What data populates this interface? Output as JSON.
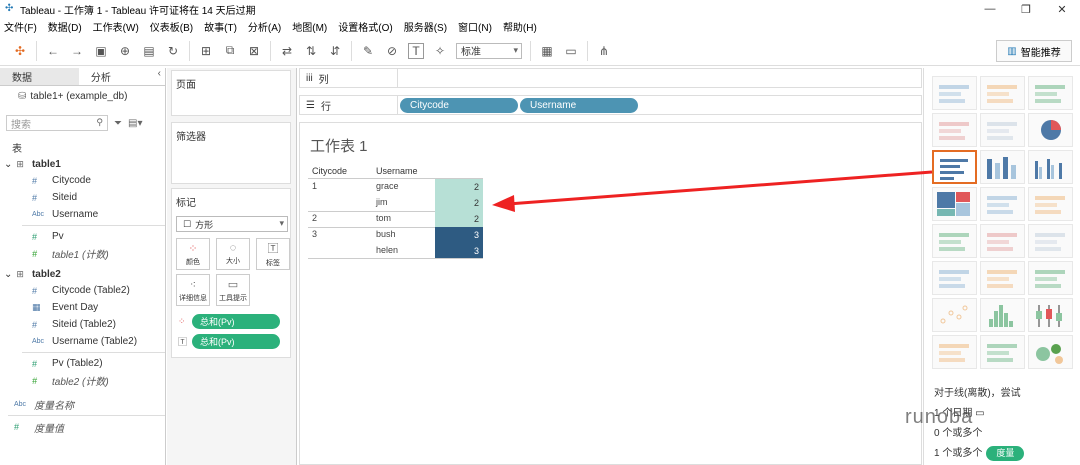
{
  "window": {
    "title": "Tableau - 工作簿 1 - Tableau 许可证将在 14 天后过期"
  },
  "menu": [
    "文件(F)",
    "数据(D)",
    "工作表(W)",
    "仪表板(B)",
    "故事(T)",
    "分析(A)",
    "地图(M)",
    "设置格式(O)",
    "服务器(S)",
    "窗口(N)",
    "帮助(H)"
  ],
  "toolbar": {
    "fit_select": "标准",
    "show_me_label": "智能推荐"
  },
  "left": {
    "tab_data": "数据",
    "tab_analysis": "分析",
    "datasource": "table1+ (example_db)",
    "search_placeholder": "搜索",
    "tables_label": "表",
    "table1": {
      "name": "table1",
      "fields": [
        "Citycode",
        "Siteid",
        "Username",
        "Pv"
      ],
      "count": "table1 (计数)"
    },
    "table2": {
      "name": "table2",
      "fields": [
        "Citycode (Table2)",
        "Event Day",
        "Siteid (Table2)",
        "Username (Table2)",
        "Pv (Table2)"
      ],
      "count": "table2 (计数)"
    },
    "measure_names": "度量名称",
    "measure_values": "度量值"
  },
  "mid": {
    "pages": "页面",
    "filters": "筛选器",
    "marks": "标记",
    "mark_type": "方形",
    "btn_color": "颜色",
    "btn_size": "大小",
    "btn_label": "标签",
    "btn_detail": "详细信息",
    "btn_tooltip": "工具提示",
    "pill1": "总和(Pv)",
    "pill2": "总和(Pv)"
  },
  "shelves": {
    "columns": "列",
    "rows": "行",
    "row_pills": [
      "Citycode",
      "Username"
    ]
  },
  "sheet": {
    "title": "工作表 1",
    "headers": [
      "Citycode",
      "Username"
    ],
    "rows": [
      {
        "city": "1",
        "user": "grace",
        "value": "2"
      },
      {
        "city": "",
        "user": "jim",
        "value": "2"
      },
      {
        "city": "2",
        "user": "tom",
        "value": "2"
      },
      {
        "city": "3",
        "user": "bush",
        "value": "3"
      },
      {
        "city": "",
        "user": "helen",
        "value": "3"
      }
    ],
    "colors": {
      "low": "#b7e0d6",
      "high": "#2e5b82"
    }
  },
  "showme": {
    "hint1": "对于线(离散)，尝试",
    "hint2": "1 个日期",
    "hint3": "0 个或多个",
    "hint4": "1 个或多个",
    "measure_pill": "度量"
  },
  "watermark": "runoba"
}
